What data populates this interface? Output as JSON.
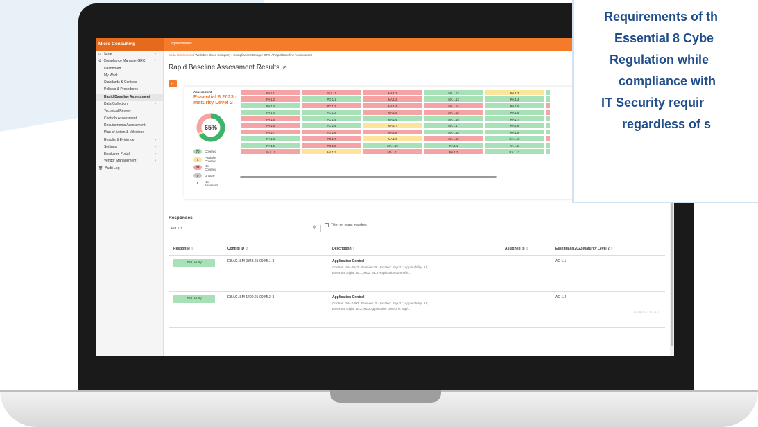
{
  "app": {
    "brand": "Micro Consulting",
    "top_link": "Organizations"
  },
  "sidebar": {
    "items": [
      {
        "label": "Home",
        "level": "top",
        "icon": "home-icon",
        "chevron": "›"
      },
      {
        "label": "Compliance Manager GRC",
        "level": "top",
        "icon": "gear-icon",
        "chevron": "˅"
      },
      {
        "label": "Dashboard"
      },
      {
        "label": "My Work"
      },
      {
        "label": "Standards & Controls"
      },
      {
        "label": "Policies & Procedures"
      },
      {
        "label": "Rapid Baseline Assessment",
        "active": true
      },
      {
        "label": "Data Collection",
        "chevron": "›"
      },
      {
        "label": "Technical Review"
      },
      {
        "label": "Controls Assessment"
      },
      {
        "label": "Requirements Assessment"
      },
      {
        "label": "Plan of Action & Milestone"
      },
      {
        "label": "Results & Evidence",
        "chevron": "›"
      },
      {
        "label": "Settings",
        "chevron": "›"
      },
      {
        "label": "Employee Portal",
        "chevron": "›"
      },
      {
        "label": "Vendor Management",
        "chevron": "›"
      },
      {
        "label": "Audit Log",
        "level": "top",
        "icon": "trash-icon"
      }
    ]
  },
  "breadcrumb": {
    "link": "Coda Distributors",
    "rest": " / Wellabee Shoe Company / Compliance Manager GRC / Rapid Baseline Assessment"
  },
  "page": {
    "title": "Rapid Baseline Assessment Results",
    "help_glyph": "⊘",
    "back_glyph": "←"
  },
  "assessment": {
    "label": "Assessment",
    "name": "Essential 8 2023 - Maturity Level 2",
    "percent_label": "65%",
    "legend": [
      {
        "count": "70",
        "label": "Covered",
        "color": "#a8e0b8"
      },
      {
        "count": "4",
        "label": "Partially Covered",
        "color": "#fbe59a"
      },
      {
        "count": "33",
        "label": "Not Covered",
        "color": "#f4a4a4"
      },
      {
        "count": "0",
        "label": "Unsure",
        "color": "#c8c8c8"
      },
      {
        "count": "0",
        "label": "Not Assessed",
        "color": "#ffffff"
      }
    ]
  },
  "colors": {
    "accent": "#f47b2a",
    "covered": "#a8e0b8",
    "partial": "#fbe59a",
    "not_covered": "#f4a4a4",
    "title_blue": "#1f4d8c"
  },
  "grid": {
    "columns": [
      {
        "cells": [
          [
            "PA 1.1",
            "r"
          ],
          [
            "PA 1.2",
            "r"
          ],
          [
            "PA 1.3",
            "g"
          ],
          [
            "PA 1.4",
            "g"
          ],
          [
            "PA 1.5",
            "r"
          ],
          [
            "PA 1.6",
            "r"
          ],
          [
            "PA 1.7",
            "r"
          ],
          [
            "PA 1.8",
            "g"
          ],
          [
            "PA 1.9",
            "g"
          ],
          [
            "PA 1.10",
            "r"
          ]
        ]
      },
      {
        "cells": [
          [
            "PA 1.11",
            "r"
          ],
          [
            "PO 1.1",
            "g"
          ],
          [
            "PO 1.2",
            "r"
          ],
          [
            "PO 1.3",
            "g"
          ],
          [
            "PO 1.4",
            "g"
          ],
          [
            "PO 1.5",
            "g"
          ],
          [
            "PO 1.6",
            "r"
          ],
          [
            "PO 1.7",
            "r"
          ],
          [
            "PO 1.8",
            "r"
          ],
          [
            "MA 1.1",
            "y"
          ]
        ]
      },
      {
        "cells": [
          [
            "MA 1.2",
            "r"
          ],
          [
            "MA 1.3",
            "r"
          ],
          [
            "MA 1.4",
            "r"
          ],
          [
            "MA 1.5",
            "r"
          ],
          [
            "MA 1.6",
            "g"
          ],
          [
            "MA 1.7",
            "y"
          ],
          [
            "MA 1.8",
            "r"
          ],
          [
            "MA 1.9",
            "y"
          ],
          [
            "MA 1.10",
            "g"
          ],
          [
            "MA 1.11",
            "r"
          ]
        ]
      },
      {
        "cells": [
          [
            "MA 1.12",
            "g"
          ],
          [
            "MA 1.13",
            "g"
          ],
          [
            "MA 1.14",
            "r"
          ],
          [
            "MA 1.15",
            "r"
          ],
          [
            "MA 1.16",
            "g"
          ],
          [
            "MA 1.17",
            "g"
          ],
          [
            "MA 1.18",
            "g"
          ],
          [
            "MA 1.19",
            "r"
          ],
          [
            "RA 1.1",
            "g"
          ],
          [
            "RA 1.2",
            "r"
          ]
        ]
      },
      {
        "cells": [
          [
            "RA 1.3",
            "y"
          ],
          [
            "RA 1.4",
            "g"
          ],
          [
            "RA 1.5",
            "g"
          ],
          [
            "RA 1.6",
            "g"
          ],
          [
            "RA 1.7",
            "g"
          ],
          [
            "RA 1.8",
            "g"
          ],
          [
            "RA 1.9",
            "g"
          ],
          [
            "RA 1.10",
            "g"
          ],
          [
            "RA 1.11",
            "g"
          ],
          [
            "RA 1.12",
            "g"
          ]
        ]
      },
      {
        "cells": [
          [
            "",
            "g"
          ],
          [
            "",
            "g"
          ],
          [
            "",
            "r"
          ],
          [
            "",
            "r"
          ],
          [
            "",
            "g"
          ],
          [
            "",
            "g"
          ],
          [
            "",
            "g"
          ],
          [
            "",
            "r"
          ],
          [
            "",
            "g"
          ],
          [
            "",
            "g"
          ]
        ]
      }
    ]
  },
  "responses": {
    "title": "Responses",
    "search_value": "PO 1.3",
    "filter_label": "Filter on exact matches",
    "columns": {
      "response": "Response",
      "control_id": "Control ID",
      "description": "Description",
      "assigned_to": "Assigned to",
      "maturity": "Essential 8 2023 Maturity Level 2"
    },
    "rows": [
      {
        "response": "Yes, Fully",
        "control_id": "E8.AC.ISM-0843.21-09.ML1-3",
        "desc_title": "Application Control",
        "desc_text": "Control: ISM-0843; Revision: 9; Updated: Sep-21; Applicability: All; Essential Eight: ML1, ML2, ML3 Application control is...",
        "maturity": "AC 1.1"
      },
      {
        "response": "Yes, Fully",
        "control_id": "E8.AC.ISM-1490.21-09.ML2-3",
        "desc_title": "Application Control",
        "desc_text": "Control: ISM-1490; Revision: 3; Updated: Sep-21; Applicability: All; Essential Eight: ML2, ML3 Application control is impl...",
        "maturity": "AC 1.2"
      }
    ],
    "timestamp": "2024.06.13.0202"
  },
  "overlay": {
    "lines": [
      "Requirements of th",
      "Essential 8 Cybe",
      "Regulation while",
      "compliance with",
      "IT Security requir",
      "regardless of s"
    ]
  }
}
